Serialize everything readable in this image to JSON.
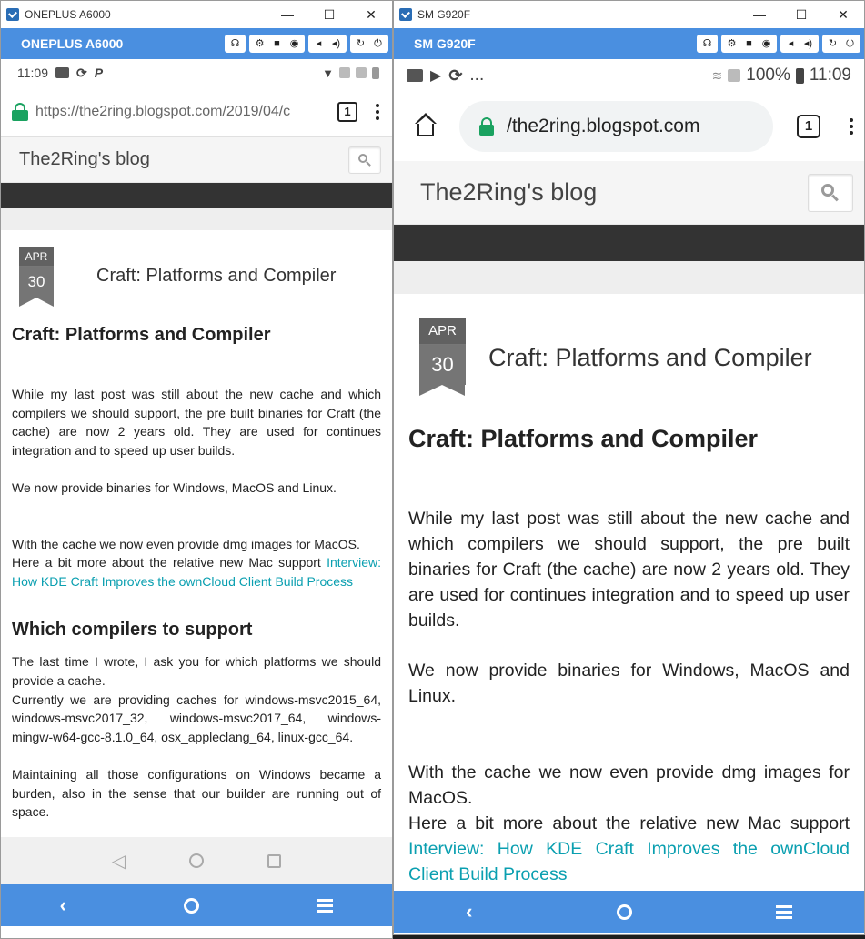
{
  "left": {
    "window_title": "ONEPLUS A6000",
    "device_name": "ONEPLUS A6000",
    "time": "11:09",
    "url": "https://the2ring.blogspot.com/2019/04/c",
    "tabs_count": "1",
    "blog_title": "The2Ring's blog",
    "date_month": "APR",
    "date_day": "30",
    "post_header_title": "Craft: Platforms and Compiler",
    "h1": "Craft: Platforms and Compiler",
    "p1": "While my last post was still about the new cache and which compilers we should support, the pre built binaries for Craft (the cache) are now 2 years old. They are used for continues integration and to speed up user builds.",
    "p2": "We now provide binaries for Windows, MacOS and Linux.",
    "p3": "With the cache we now even provide dmg images for MacOS.",
    "p4_text": "Here a bit more about the relative new Mac support ",
    "p4_link": "Interview: How KDE Craft Improves the ownCloud Client Build Process",
    "h2": "Which compilers to support",
    "p5": "The last time I wrote, I ask you for which platforms we should provide a cache.",
    "p6": "Currently we are providing caches for windows-msvc2015_64, windows-msvc2017_32, windows-msvc2017_64, windows-mingw-w64-gcc-8.1.0_64, osx_appleclang_64, linux-gcc_64.",
    "p7": "Maintaining all those configurations on Windows became a burden, also in the sense that our builder are running out of space."
  },
  "right": {
    "window_title": "SM G920F",
    "device_name": "SM G920F",
    "status_dots": "...",
    "battery": "100%",
    "time": "11:09",
    "url": "/the2ring.blogspot.com",
    "tabs_count": "1",
    "blog_title": "The2Ring's blog",
    "date_month": "APR",
    "date_day": "30",
    "post_header_title": "Craft: Platforms and Compiler",
    "h1": "Craft: Platforms and Compiler",
    "p1": "While my last post was still about the new cache and which compilers we should support, the pre built binaries for Craft (the cache) are now 2 years old. They are used for continues integration and to speed up user builds.",
    "p2": "We now provide binaries for Windows, MacOS and Linux.",
    "p3": "With the cache we now even provide dmg images for MacOS.",
    "p4_text": "Here a bit more about the relative new Mac support ",
    "p4_link": "Interview: How KDE Craft Improves the ownCloud Client Build Process"
  },
  "window_controls": {
    "minimize": "—",
    "maximize": "☐",
    "close": "✕"
  },
  "colors": {
    "toolbar_blue": "#4a8fe0",
    "lock_green": "#1aa260",
    "link_teal": "#0a9fb0",
    "dark_bar": "#333333"
  }
}
